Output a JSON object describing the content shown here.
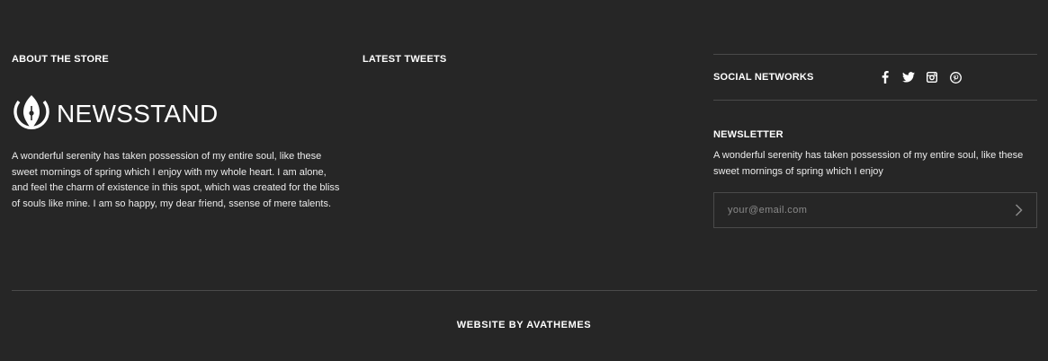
{
  "about": {
    "heading": "ABOUT THE STORE",
    "logo_text": "NEWSSTAND",
    "logo_icon": "fountain-pen-nib-icon",
    "text": "A wonderful serenity has taken possession of my entire soul, like these sweet mornings of spring which I enjoy with my whole heart. I am alone, and feel the charm of existence in this spot, which was created for the bliss of souls like mine. I am so happy, my dear friend, ssense of mere talents."
  },
  "tweets": {
    "heading": "LATEST TWEETS"
  },
  "social": {
    "heading": "SOCIAL NETWORKS",
    "icons": [
      "facebook-icon",
      "twitter-icon",
      "instagram-icon",
      "pinterest-icon"
    ]
  },
  "newsletter": {
    "heading": "NEWSLETTER",
    "text": "A wonderful serenity has taken possession of my entire soul, like these sweet mornings of spring which I enjoy",
    "email_placeholder": "your@email.com",
    "email_value": "",
    "submit_icon": "chevron-right-icon"
  },
  "credit": "WEBSITE BY AVATHEMES",
  "colors": {
    "background": "#262626",
    "text": "#ffffff",
    "divider": "#4a4a4a"
  }
}
